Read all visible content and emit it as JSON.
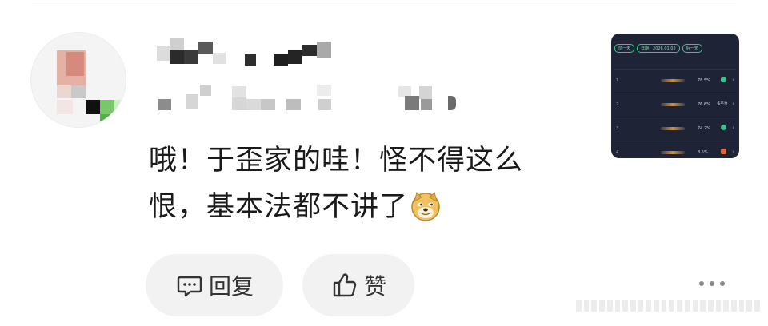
{
  "comment": {
    "lines": [
      "哦！于歪家的哇！怪不得这么",
      "恨，基本法都不讲了"
    ],
    "emoji": "doge-emoji"
  },
  "actions": {
    "reply_label": "回复",
    "like_label": "赞"
  },
  "thumbnail": {
    "nav": [
      "前一天",
      "日期：2026.01.02",
      "后一天"
    ],
    "rows": [
      {
        "rank": "1",
        "pct": "78.5%"
      },
      {
        "rank": "2",
        "pct": "76.6%",
        "action": "多平台"
      },
      {
        "rank": "3",
        "pct": "74.2%"
      },
      {
        "rank": "4",
        "pct": "8.5%"
      }
    ]
  },
  "colors": {
    "background": "#ffffff",
    "button_bg": "#f2f2f2",
    "text": "#1a1a1a",
    "thumb_bg": "#1e2336",
    "thumb_accent": "#3ec28a"
  }
}
